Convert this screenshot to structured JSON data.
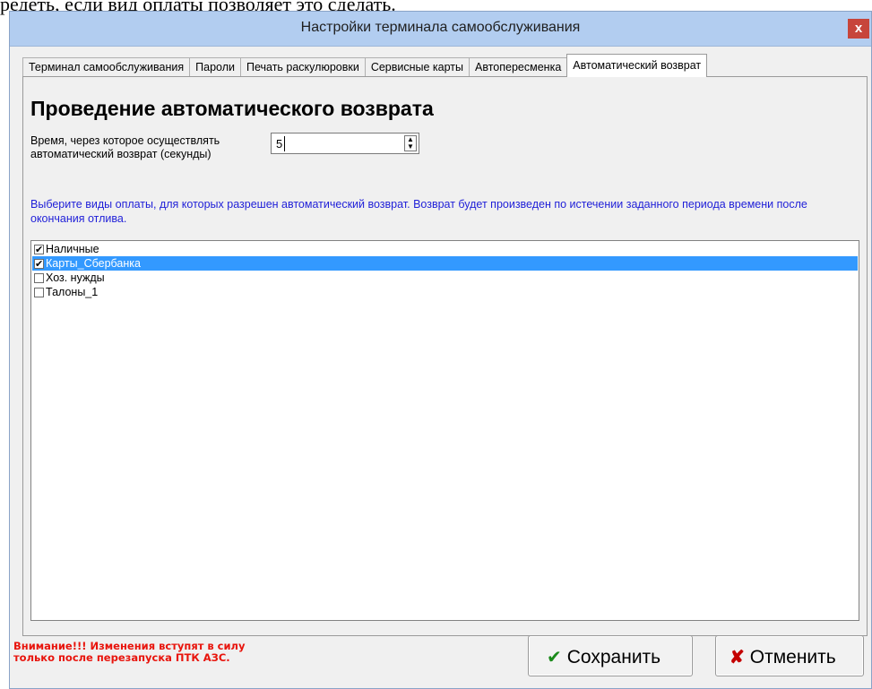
{
  "document_text": "редеть, если вид оплаты позволяет это сделать.",
  "window": {
    "title": "Настройки терминала самообслуживания",
    "close_glyph": "x"
  },
  "tabs": [
    {
      "label": "Терминал самообслуживания",
      "active": false
    },
    {
      "label": "Пароли",
      "active": false
    },
    {
      "label": "Печать раскулюровки",
      "active": false
    },
    {
      "label": "Сервисные карты",
      "active": false
    },
    {
      "label": "Автопересменка",
      "active": false
    },
    {
      "label": "Автоматический возврат",
      "active": true
    }
  ],
  "panel": {
    "heading": "Проведение автоматического возврата",
    "time_label_line1": "Время, через которое осуществлять",
    "time_label_line2": "автоматический  возврат (секунды)",
    "time_value": "5",
    "hint_text": "Выберите виды оплаты, для которых разрешен автоматический возврат. Возврат будет произведен по истечении заданного периода времени после окончания отлива.",
    "payment_types": [
      {
        "label": "Наличные",
        "checked": true,
        "selected": false
      },
      {
        "label": "Карты_Сбербанка",
        "checked": true,
        "selected": true
      },
      {
        "label": "Хоз. нужды",
        "checked": false,
        "selected": false
      },
      {
        "label": "Талоны_1",
        "checked": false,
        "selected": false
      }
    ]
  },
  "footer": {
    "warning_line1": "Внимание!!! Изменения вступят в силу",
    "warning_line2": "только после перезапуска ПТК АЗС.",
    "save_label": "Сохранить",
    "cancel_label": "Отменить"
  },
  "colors": {
    "titlebar": "#b2cdf0",
    "selection": "#3399ff",
    "hint_text": "#1f1fd8",
    "warning_text": "#e8140c",
    "close_button": "#c7453b"
  }
}
